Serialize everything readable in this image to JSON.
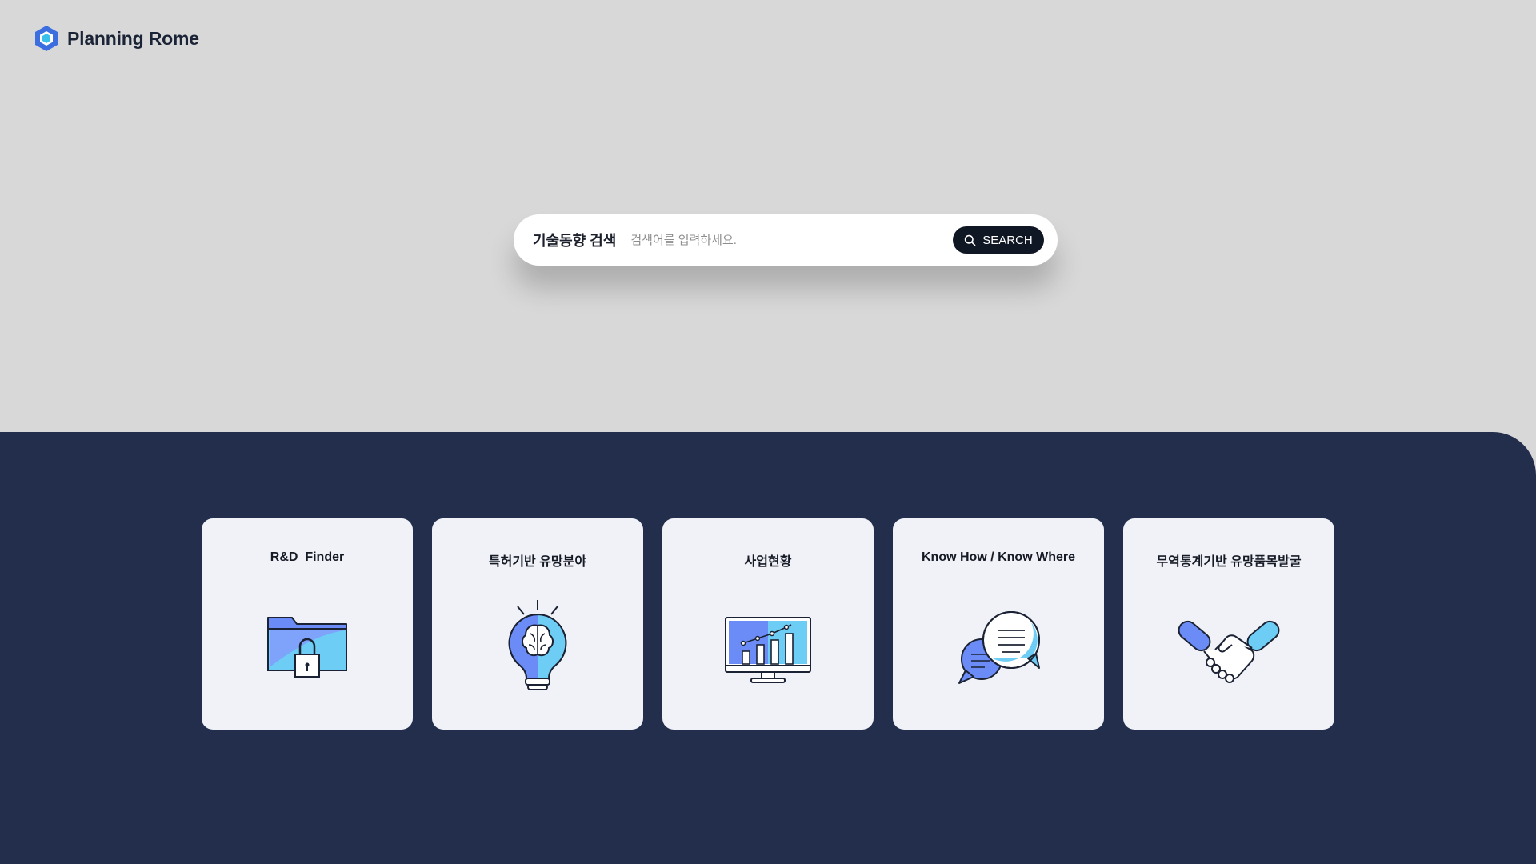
{
  "header": {
    "brand": "Planning Rome",
    "logo_icon": "hexagon-logo-icon"
  },
  "search": {
    "label": "기술동향 검색",
    "placeholder": "검색어를 입력하세요.",
    "value": "",
    "button_label": "SEARCH",
    "button_icon": "search-icon"
  },
  "colors": {
    "page_background": "#d8d8d8",
    "panel_background": "#222e4b",
    "card_background": "#f0f2f7",
    "button_background": "#0f1624",
    "accent_blue": "#6b8cf6",
    "accent_cyan": "#6dcdf5"
  },
  "cards": [
    {
      "title": "R&D  Finder",
      "icon": "locked-folder-icon"
    },
    {
      "title": "특허기반 유망분야",
      "icon": "lightbulb-brain-icon"
    },
    {
      "title": "사업현황",
      "icon": "monitor-chart-icon"
    },
    {
      "title": "Know How / Know Where",
      "icon": "chat-bubbles-icon"
    },
    {
      "title": "무역통계기반 유망품목발굴",
      "icon": "handshake-icon"
    }
  ]
}
